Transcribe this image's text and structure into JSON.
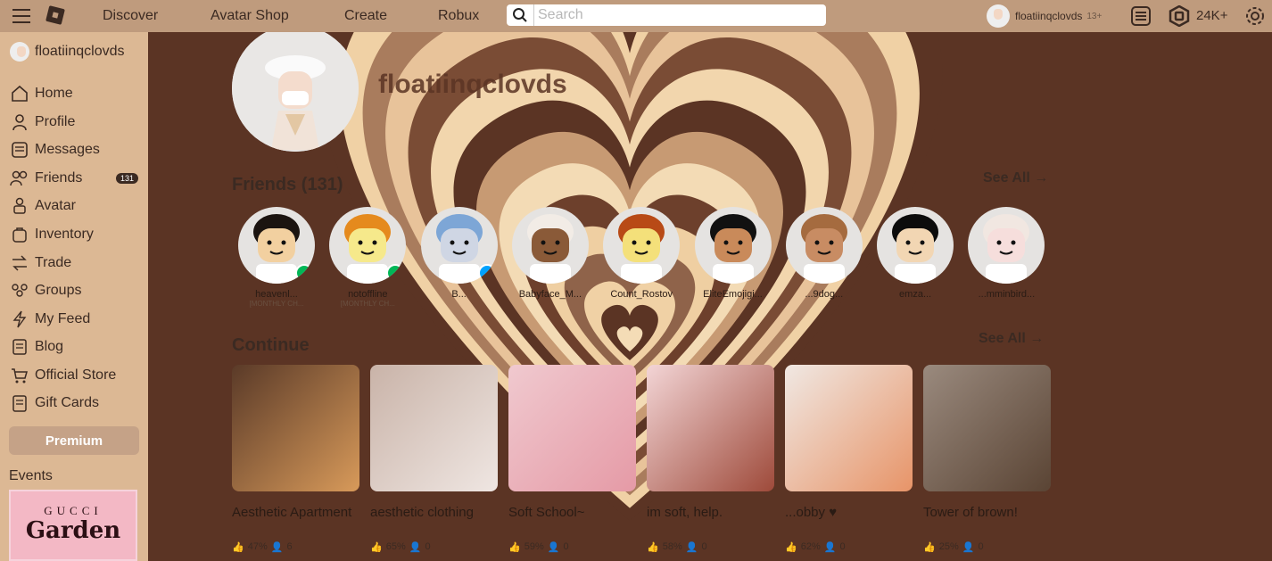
{
  "topbar": {
    "nav": [
      "Discover",
      "Avatar Shop",
      "Create",
      "Robux"
    ],
    "search_placeholder": "Search",
    "username": "floatiinqclovds",
    "age_label": "13+",
    "robux": "24K+"
  },
  "sidebar": {
    "username": "floatiinqclovds",
    "items": [
      {
        "label": "Home",
        "icon": "home-icon"
      },
      {
        "label": "Profile",
        "icon": "profile-icon"
      },
      {
        "label": "Messages",
        "icon": "messages-icon"
      },
      {
        "label": "Friends",
        "icon": "friends-icon",
        "badge": "131"
      },
      {
        "label": "Avatar",
        "icon": "avatar-icon"
      },
      {
        "label": "Inventory",
        "icon": "inventory-icon"
      },
      {
        "label": "Trade",
        "icon": "trade-icon"
      },
      {
        "label": "Groups",
        "icon": "groups-icon"
      },
      {
        "label": "My Feed",
        "icon": "feed-icon"
      },
      {
        "label": "Blog",
        "icon": "blog-icon"
      },
      {
        "label": "Official Store",
        "icon": "store-icon"
      },
      {
        "label": "Gift Cards",
        "icon": "gift-cards-icon"
      }
    ],
    "premium": "Premium",
    "events_label": "Events",
    "event_banner": {
      "line1": "GUCCI",
      "line2": "Garden"
    }
  },
  "main": {
    "profile_name": "floatiinqclovds",
    "friends_title": "Friends (131)",
    "friends_see_all": "See All →",
    "friends": [
      {
        "name": "heavenl...",
        "status": "[MONTHLY CH...",
        "presence": "game",
        "skin": "#f2d0a0",
        "hair": "#1b1410"
      },
      {
        "name": "notoffline",
        "status": "[MONTHLY CH...",
        "presence": "game",
        "skin": "#f6e98b",
        "hair": "#e58a1d"
      },
      {
        "name": "B...",
        "status": "",
        "presence": "online",
        "skin": "#cfd6e4",
        "hair": "#7da6d6"
      },
      {
        "name": "Babyface_M...",
        "status": "",
        "presence": "",
        "skin": "#8a5a38",
        "hair": "#f2ece6"
      },
      {
        "name": "Count_Rostov",
        "status": "",
        "presence": "",
        "skin": "#f4e07a",
        "hair": "#b84a16"
      },
      {
        "name": "EliteEmojigi...",
        "status": "",
        "presence": "",
        "skin": "#c98a5a",
        "hair": "#111111"
      },
      {
        "name": "...9dog...",
        "status": "",
        "presence": "",
        "skin": "#c88c63",
        "hair": "#a56b3f"
      },
      {
        "name": "emza...",
        "status": "",
        "presence": "",
        "skin": "#f2d6b3",
        "hair": "#0c0c0c"
      },
      {
        "name": "...mminbird...",
        "status": "",
        "presence": "",
        "skin": "#f6dedc",
        "hair": "#f1e7e1"
      }
    ],
    "continue_title": "Continue",
    "continue_see_all": "See All →",
    "games": [
      {
        "name": "Aesthetic Apartment",
        "rating": "47%",
        "players": "6",
        "color1": "#5a3a28",
        "color2": "#d89a5a"
      },
      {
        "name": "aesthetic clothing",
        "rating": "65%",
        "players": "0",
        "color1": "#c9b3a8",
        "color2": "#efe6e2"
      },
      {
        "name": "Soft School~",
        "rating": "59%",
        "players": "0",
        "color1": "#f0c9cf",
        "color2": "#e59aa6"
      },
      {
        "name": "im soft, help.",
        "rating": "58%",
        "players": "0",
        "color1": "#f3d5d6",
        "color2": "#9e4a3a"
      },
      {
        "name": "...obby ♥",
        "rating": "62%",
        "players": "0",
        "color1": "#f0e8e3",
        "color2": "#e79468"
      },
      {
        "name": "Tower of brown!",
        "rating": "25%",
        "players": "0",
        "color1": "#9a8a7e",
        "color2": "#5a4434"
      }
    ]
  }
}
